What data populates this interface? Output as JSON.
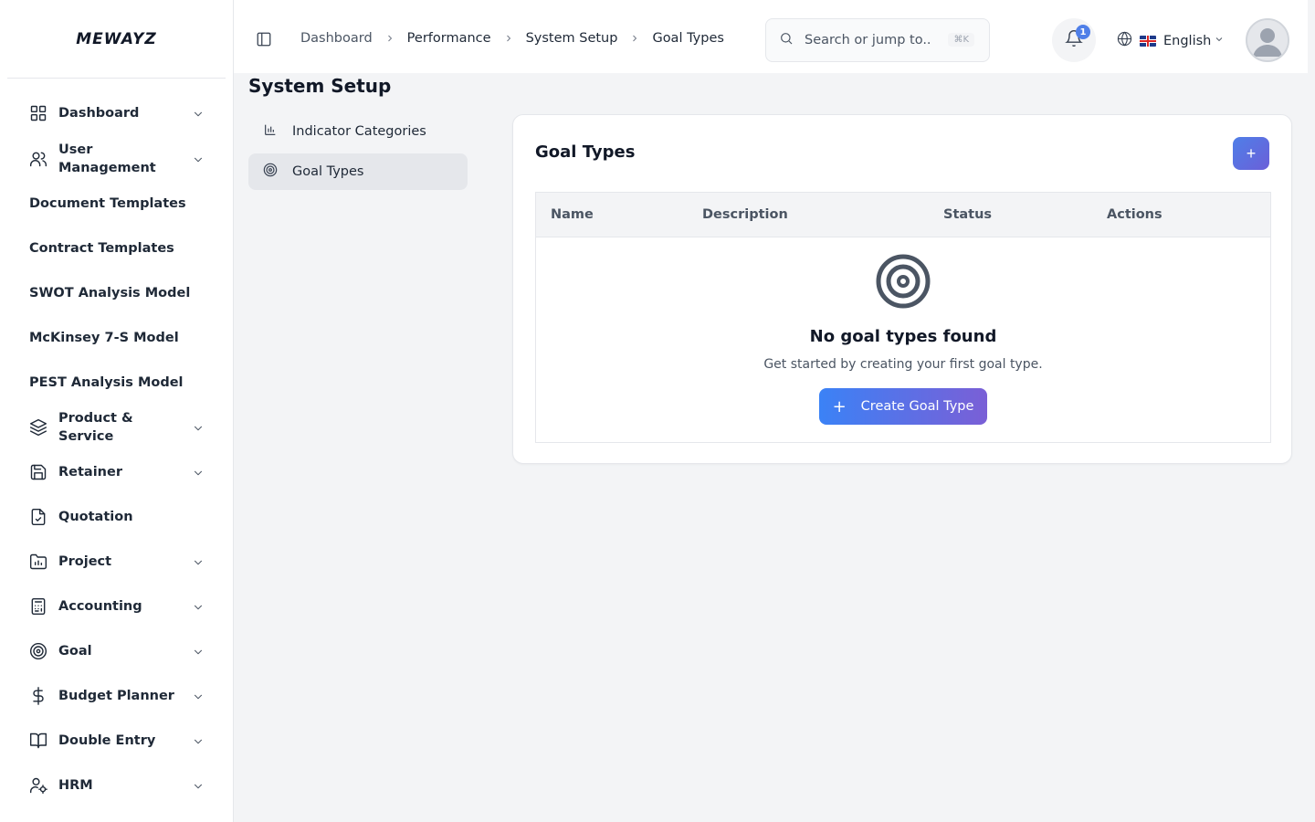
{
  "brand": {
    "logo_text": "MEWAYZ"
  },
  "sidebar": {
    "items": [
      {
        "label": "Dashboard",
        "icon": "grid-icon",
        "chevron": true
      },
      {
        "label": "User Management",
        "icon": "users-icon",
        "chevron": true
      },
      {
        "label": "Document Templates",
        "icon": "",
        "chevron": false
      },
      {
        "label": "Contract Templates",
        "icon": "",
        "chevron": false
      },
      {
        "label": "SWOT Analysis Model",
        "icon": "",
        "chevron": false
      },
      {
        "label": "McKinsey 7-S Model",
        "icon": "",
        "chevron": false
      },
      {
        "label": "PEST Analysis Model",
        "icon": "",
        "chevron": false
      },
      {
        "label": "Product & Service",
        "icon": "layers-icon",
        "chevron": true
      },
      {
        "label": "Retainer",
        "icon": "save-icon",
        "chevron": true
      },
      {
        "label": "Quotation",
        "icon": "file-check-icon",
        "chevron": false
      },
      {
        "label": "Project",
        "icon": "folder-chart-icon",
        "chevron": true
      },
      {
        "label": "Accounting",
        "icon": "calculator-icon",
        "chevron": true
      },
      {
        "label": "Goal",
        "icon": "target-icon",
        "chevron": true
      },
      {
        "label": "Budget Planner",
        "icon": "dollar-icon",
        "chevron": true
      },
      {
        "label": "Double Entry",
        "icon": "book-open-icon",
        "chevron": true
      },
      {
        "label": "HRM",
        "icon": "user-cog-icon",
        "chevron": true
      }
    ]
  },
  "header": {
    "breadcrumb": [
      "Dashboard",
      "Performance",
      "System Setup",
      "Goal Types"
    ],
    "search": {
      "placeholder": "Search or jump to...",
      "shortcut": "⌘K"
    },
    "notifications": {
      "count": "1"
    },
    "language": {
      "label": "English",
      "flag": "uk-flag"
    }
  },
  "page": {
    "title": "System Setup",
    "sub_nav": [
      {
        "label": "Indicator Categories",
        "icon": "bar-chart-icon",
        "active": false
      },
      {
        "label": "Goal Types",
        "icon": "target-icon",
        "active": true
      }
    ]
  },
  "card": {
    "title": "Goal Types",
    "add_label": "+",
    "columns": [
      "Name",
      "Description",
      "Status",
      "Actions"
    ],
    "empty": {
      "title": "No goal types found",
      "subtitle": "Get started by creating your first goal type.",
      "button_label": "Create Goal Type",
      "button_icon": "+"
    }
  },
  "colors": {
    "accent_start": "#3b82f6",
    "accent_end": "#7a5fd6",
    "badge": "#4f7fe8"
  }
}
